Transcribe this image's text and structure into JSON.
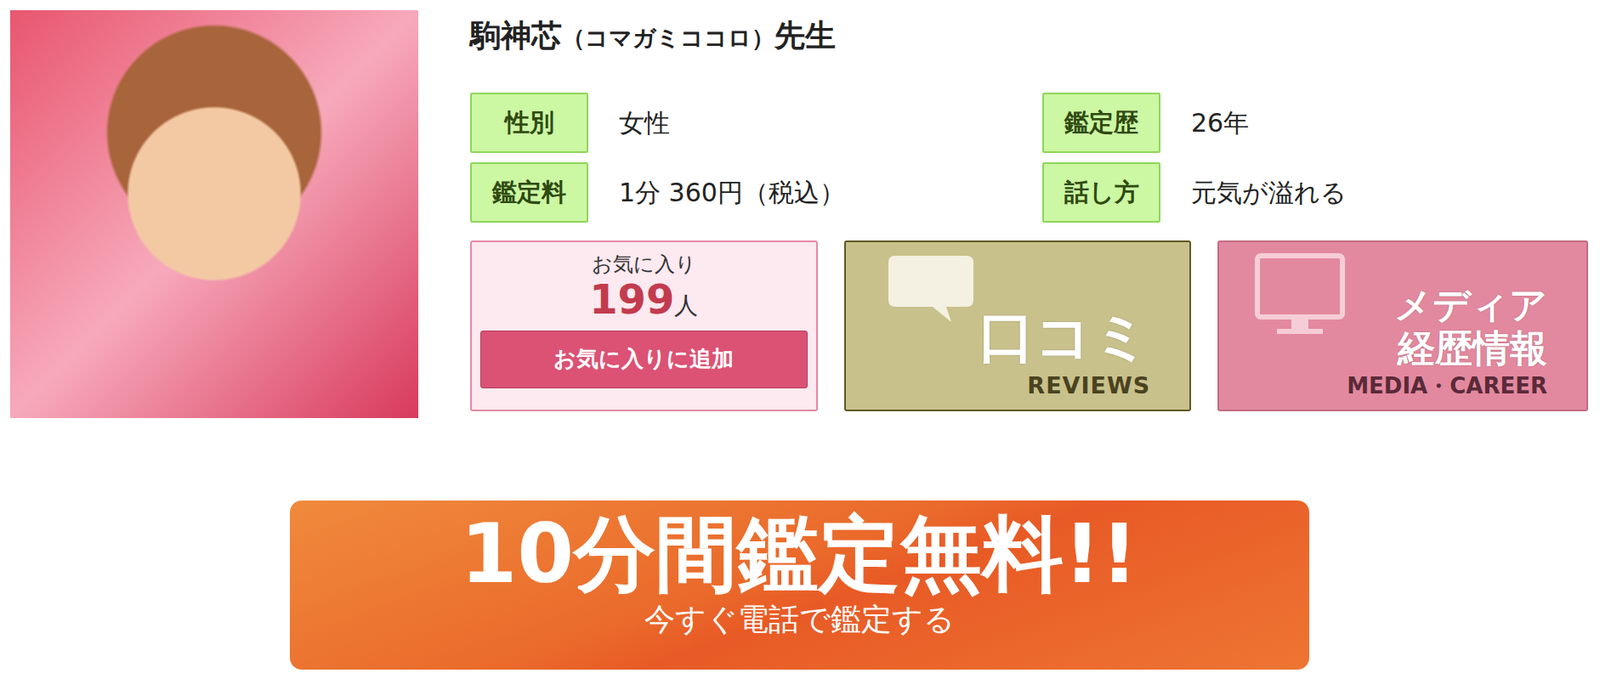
{
  "profile": {
    "name": "駒神芯",
    "reading": "（コマガミココロ）",
    "suffix": "先生"
  },
  "info": [
    {
      "label": "性別",
      "value": "女性"
    },
    {
      "label": "鑑定歴",
      "value": "26年"
    },
    {
      "label": "鑑定料",
      "value": "1分 360円（税込）"
    },
    {
      "label": "話し方",
      "value": "元気が溢れる"
    }
  ],
  "favorite": {
    "caption": "お気に入り",
    "count": "199",
    "unit": "人",
    "button": "お気に入りに追加"
  },
  "reviews": {
    "title": "口コミ",
    "subtitle": "REVIEWS"
  },
  "media": {
    "title_lines": [
      "メディア",
      "経歴情報"
    ],
    "subtitle": "MEDIA・CAREER"
  },
  "banner": {
    "title": "10分間鑑定無料!!",
    "subtitle": "今すぐ電話で鑑定する"
  }
}
